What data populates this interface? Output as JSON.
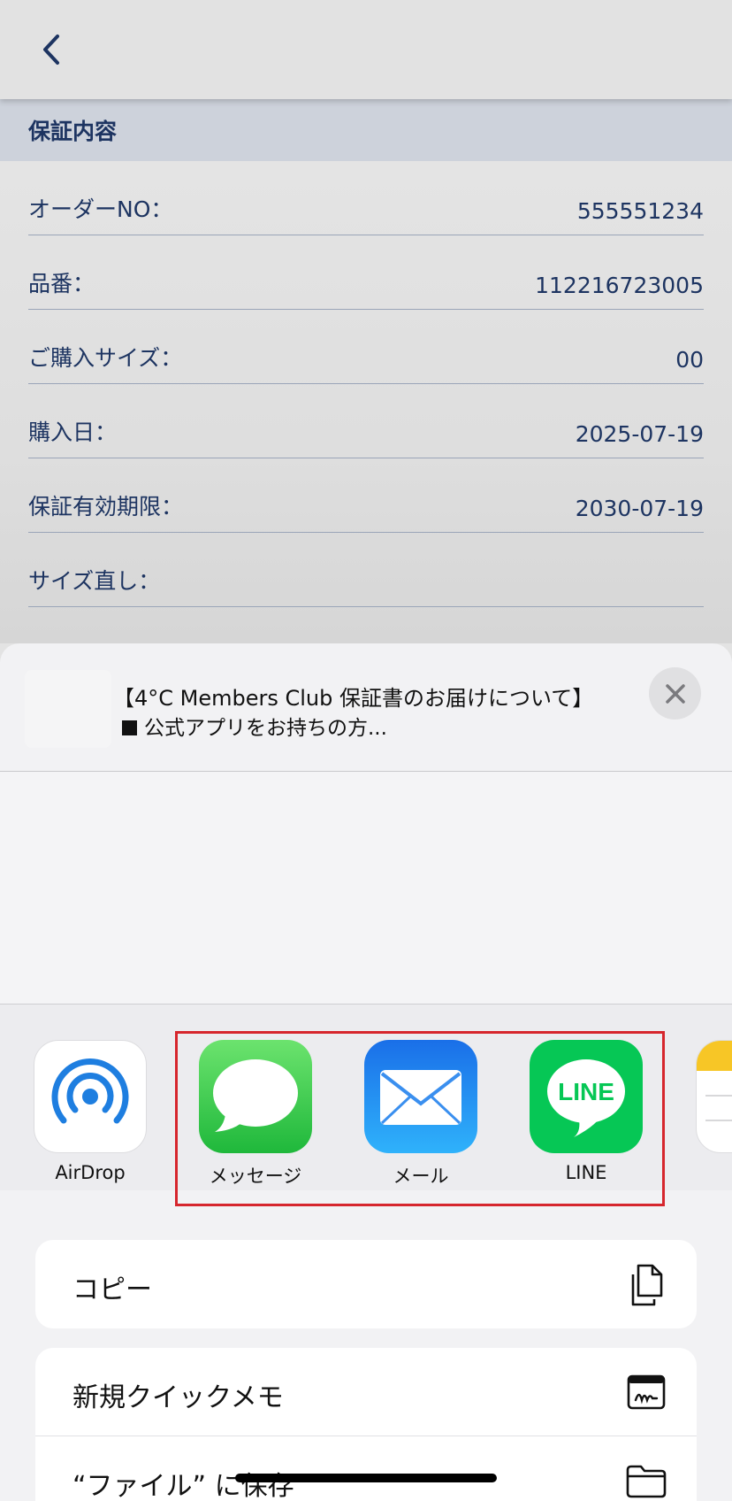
{
  "nav": {
    "back_icon": "chevron-left-icon"
  },
  "warranty": {
    "section_title": "保証内容",
    "rows": [
      {
        "label": "オーダーNO：",
        "value": "555551234"
      },
      {
        "label": "品番：",
        "value": "112216723005"
      },
      {
        "label": "ご購入サイズ：",
        "value": "00"
      },
      {
        "label": "購入日：",
        "value": "2025-07-19"
      },
      {
        "label": "保証有効期限：",
        "value": "2030-07-19"
      },
      {
        "label": "サイズ直し：",
        "value": ""
      }
    ]
  },
  "share_sheet": {
    "preview": {
      "title": "【4°C Members Club 保証書のお届けについて】",
      "subtitle": "公式アプリをお持ちの方..."
    },
    "close_icon": "close-icon",
    "apps": [
      {
        "label": "AirDrop",
        "icon": "airdrop-icon"
      },
      {
        "label": "メッセージ",
        "icon": "messages-icon"
      },
      {
        "label": "メール",
        "icon": "mail-icon"
      },
      {
        "label": "LINE",
        "icon": "line-icon"
      }
    ],
    "line_logo_text": "LINE",
    "actions": [
      {
        "label": "コピー",
        "icon": "copy-icon"
      },
      {
        "label": "新規クイックメモ",
        "icon": "quick-note-icon"
      },
      {
        "label": "“ファイル” に保存",
        "icon": "folder-icon"
      }
    ]
  },
  "colors": {
    "navy": "#1d3461",
    "highlight": "#d6262d",
    "line_green": "#06c755",
    "messages_green": "#34c759",
    "mail_blue": "#1e88f0"
  }
}
